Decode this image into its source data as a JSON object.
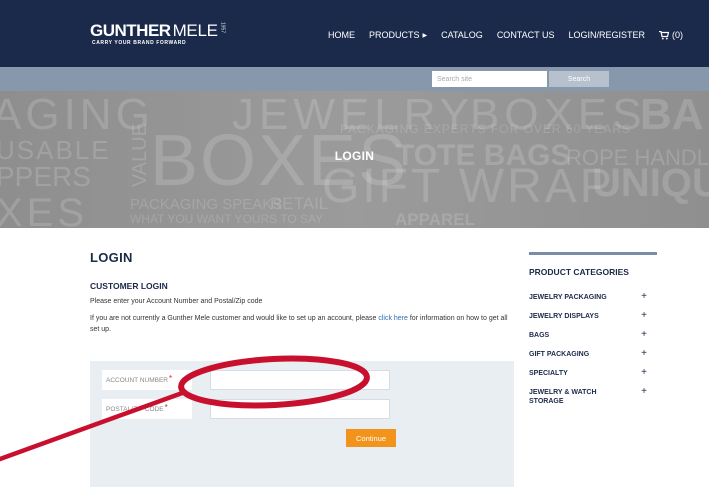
{
  "header": {
    "logo_bold": "GUNTHER",
    "logo_light": "MELE",
    "logo_year": "1957",
    "logo_tagline": "CARRY YOUR BRAND FORWARD",
    "nav": {
      "home": "HOME",
      "products": "PRODUCTS",
      "catalog": "CATALOG",
      "contact": "CONTACT US",
      "login": "LOGIN/REGISTER",
      "cart_count": "(0)"
    },
    "background_color": "#1b2a4b"
  },
  "search": {
    "placeholder": "Search site",
    "button_label": "Search"
  },
  "hero": {
    "title": "LOGIN",
    "background_words": [
      "AGING",
      "JEWELRY",
      "BOXES",
      "BA",
      "USABLE",
      "BOXES",
      "TOTE BAGS",
      "ROPE HANDLE",
      "PPERS",
      "VALUE",
      "GIFT WRAP",
      "UNIQU",
      "XES",
      "PACKAGING SPEAKS",
      "RETAIL",
      "WHAT YOU WANT YOURS TO SAY",
      "APPAREL",
      "PACKAGING EXPERTS FOR OVER 60 YEARS"
    ]
  },
  "main": {
    "page_title": "LOGIN",
    "section_title": "CUSTOMER LOGIN",
    "instruction": "Please enter your Account Number and Postal/Zip code",
    "info_prefix": "If you are not currently a Gunther Mele customer and would like to set up an account, please ",
    "info_link": "click here",
    "info_suffix": " for information on how to get all set up."
  },
  "form": {
    "account_label": "ACCOUNT NUMBER",
    "account_value": "",
    "zip_label": "POSTAL/ZIP CODE",
    "zip_value": "",
    "required_mark": "*",
    "continue_label": "Continue",
    "continue_color": "#f2941c"
  },
  "sidebar": {
    "title": "PRODUCT CATEGORIES",
    "items": [
      {
        "label": "JEWELRY PACKAGING"
      },
      {
        "label": "JEWELRY DISPLAYS"
      },
      {
        "label": "BAGS"
      },
      {
        "label": "GIFT PACKAGING"
      },
      {
        "label": "SPECIALTY"
      },
      {
        "label": "JEWELRY & WATCH STORAGE"
      }
    ],
    "expand_symbol": "+"
  },
  "annotation": {
    "color": "#c8102e"
  }
}
